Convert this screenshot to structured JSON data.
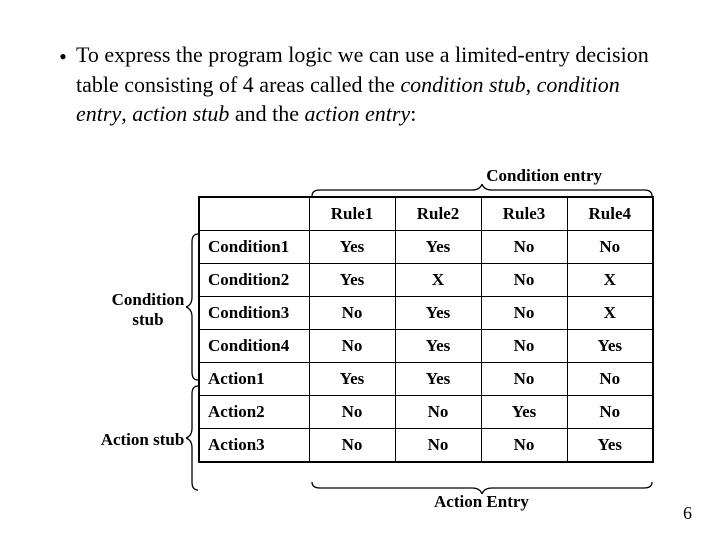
{
  "bullet": {
    "pre1": "To express the program logic we can use a limited-entry decision table consisting of 4 areas called the ",
    "i1": "condition stub",
    "sep1": ", ",
    "i2": "condition entry",
    "sep2": ", ",
    "i3": "action stub",
    "mid": " and the ",
    "i4": "action entry",
    "post": ":"
  },
  "labels": {
    "condition_entry": "Condition entry",
    "condition_stub_a": "Condition",
    "condition_stub_b": "stub",
    "action_stub": "Action stub",
    "action_entry": "Action Entry"
  },
  "table": {
    "headers": [
      "Rule1",
      "Rule2",
      "Rule3",
      "Rule4"
    ],
    "rows": [
      {
        "name": "Condition1",
        "cells": [
          "Yes",
          "Yes",
          "No",
          "No"
        ]
      },
      {
        "name": "Condition2",
        "cells": [
          "Yes",
          "X",
          "No",
          "X"
        ]
      },
      {
        "name": "Condition3",
        "cells": [
          "No",
          "Yes",
          "No",
          "X"
        ]
      },
      {
        "name": "Condition4",
        "cells": [
          "No",
          "Yes",
          "No",
          "Yes"
        ]
      },
      {
        "name": "Action1",
        "cells": [
          "Yes",
          "Yes",
          "No",
          "No"
        ]
      },
      {
        "name": "Action2",
        "cells": [
          "No",
          "No",
          "Yes",
          "No"
        ]
      },
      {
        "name": "Action3",
        "cells": [
          "No",
          "No",
          "No",
          "Yes"
        ]
      }
    ]
  },
  "chart_data": {
    "type": "table",
    "columns": [
      "",
      "Rule1",
      "Rule2",
      "Rule3",
      "Rule4"
    ],
    "rows": [
      [
        "Condition1",
        "Yes",
        "Yes",
        "No",
        "No"
      ],
      [
        "Condition2",
        "Yes",
        "X",
        "No",
        "X"
      ],
      [
        "Condition3",
        "No",
        "Yes",
        "No",
        "X"
      ],
      [
        "Condition4",
        "No",
        "Yes",
        "No",
        "Yes"
      ],
      [
        "Action1",
        "Yes",
        "Yes",
        "No",
        "No"
      ],
      [
        "Action2",
        "No",
        "No",
        "Yes",
        "No"
      ],
      [
        "Action3",
        "No",
        "No",
        "No",
        "Yes"
      ]
    ]
  },
  "page_number": "6"
}
